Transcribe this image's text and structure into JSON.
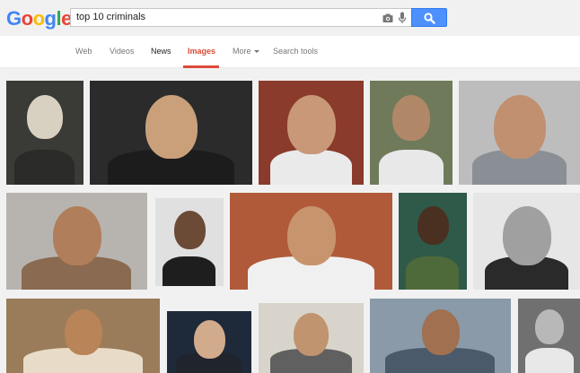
{
  "logo": {
    "letters": [
      "G",
      "o",
      "o",
      "g",
      "l",
      "e"
    ],
    "colors": [
      "#4285f4",
      "#ea4335",
      "#fbbc05",
      "#4285f4",
      "#34a853",
      "#ea4335"
    ]
  },
  "search": {
    "query": "top 10 criminals"
  },
  "tabs": [
    {
      "label": "Web",
      "state": "normal"
    },
    {
      "label": "Videos",
      "state": "normal"
    },
    {
      "label": "News",
      "state": "bold"
    },
    {
      "label": "Images",
      "state": "active"
    },
    {
      "label": "More",
      "state": "normal",
      "dropdown": true
    },
    {
      "label": "Search tools",
      "state": "normal"
    }
  ],
  "colors": {
    "accent": "#dd4b39",
    "search_button": "#4d90fe"
  },
  "results": [
    {
      "desc": "man in fedora hat, sepia photo",
      "bg": "#3a3a36",
      "skin": "#d8d0c0",
      "cloth": "#2a2a28"
    },
    {
      "desc": "close-up of grey-bearded man in glasses",
      "bg": "#2b2b2b",
      "skin": "#c9a07a",
      "cloth": "#1c1c1c"
    },
    {
      "desc": "bearded man in white kurta speaking at microphone",
      "bg": "#8a3b2b",
      "skin": "#c89878",
      "cloth": "#eaeaea"
    },
    {
      "desc": "man in white turban with grey beard",
      "bg": "#6f7a5a",
      "skin": "#b08868",
      "cloth": "#e8e8e8"
    },
    {
      "desc": "man with moustache in grey jacket",
      "bg": "#bdbdbd",
      "skin": "#c09070",
      "cloth": "#8a8f96"
    },
    {
      "desc": "tattooed shirtless young man",
      "bg": "#b7b4b0",
      "skin": "#b07e5a",
      "cloth": "#8a6a50"
    },
    {
      "desc": "mugshot of man holding placard",
      "bg": "#e0e0e0",
      "skin": "#6b4a36",
      "cloth": "#1e1e1e"
    },
    {
      "desc": "man in orange turban gesturing at podium",
      "bg": "#b05a3a",
      "skin": "#c8946e",
      "cloth": "#f0f0f0"
    },
    {
      "desc": "man in military beret and uniform",
      "bg": "#2f5a4a",
      "skin": "#4a3020",
      "cloth": "#4f6a3a"
    },
    {
      "desc": "black and white group photo of men",
      "bg": "#e6e6e6",
      "skin": "#a0a0a0",
      "cloth": "#2a2a2a"
    },
    {
      "desc": "man with moustache and sunglasses",
      "bg": "#9a7c5a",
      "skin": "#b88458",
      "cloth": "#e8dcc8"
    },
    {
      "desc": "grey-haired man in suit",
      "bg": "#1e2a3a",
      "skin": "#d2aa8c",
      "cloth": "#20242c"
    },
    {
      "desc": "mugshot of bald bearded young man",
      "bg": "#d8d4cc",
      "skin": "#c0946e",
      "cloth": "#606060"
    },
    {
      "desc": "man in patterned shirt reclining",
      "bg": "#8a9aa8",
      "skin": "#a07050",
      "cloth": "#4a5a6a"
    },
    {
      "desc": "man in white turban, black and white",
      "bg": "#707070",
      "skin": "#b8b8b8",
      "cloth": "#e8e8e8"
    }
  ]
}
